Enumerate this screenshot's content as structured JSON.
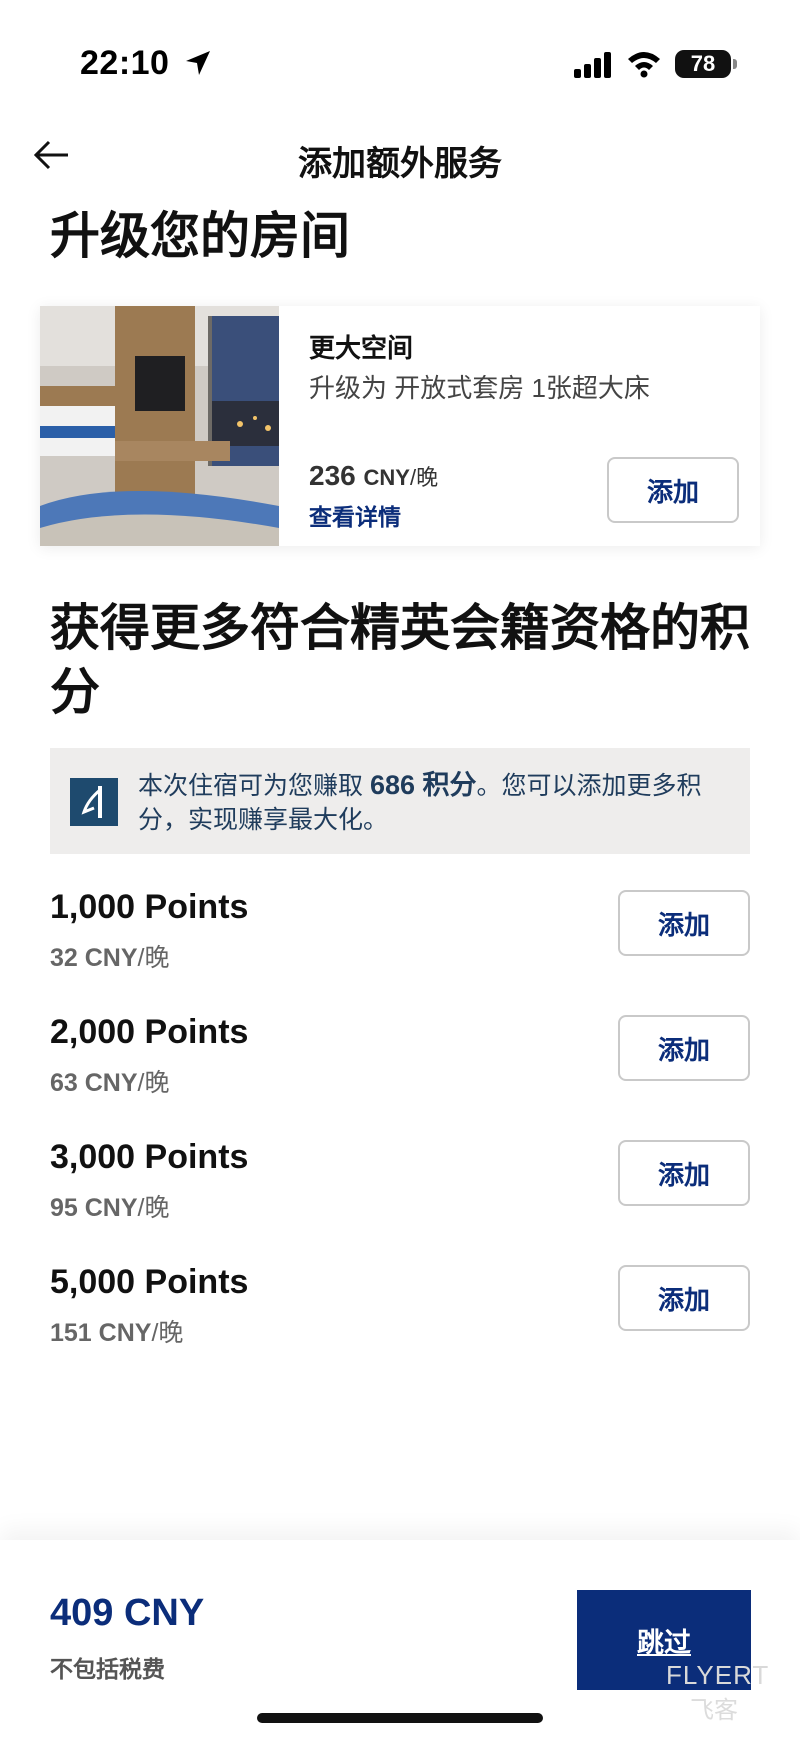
{
  "status_bar": {
    "time": "22:10",
    "battery": "78"
  },
  "header": {
    "title": "添加额外服务"
  },
  "upgrade_section": {
    "title": "升级您的房间",
    "card": {
      "heading": "更大空间",
      "description": "升级为 开放式套房 1张超大床",
      "price_value": "236",
      "price_currency": "CNY",
      "price_per": "/晚",
      "details_link": "查看详情",
      "add_label": "添加"
    }
  },
  "points_section": {
    "title": "获得更多符合精英会籍资格的积分",
    "info": {
      "prefix": "本次住宿可为您赚取 ",
      "points": "686 积分",
      "suffix": "。您可以添加更多积分，实现赚享最大化。"
    },
    "items": [
      {
        "title": "1,000 Points",
        "price": "32 CNY",
        "per": "/晚",
        "add_label": "添加"
      },
      {
        "title": "2,000 Points",
        "price": "63 CNY",
        "per": "/晚",
        "add_label": "添加"
      },
      {
        "title": "3,000 Points",
        "price": "95 CNY",
        "per": "/晚",
        "add_label": "添加"
      },
      {
        "title": "5,000 Points",
        "price": "151 CNY",
        "per": "/晚",
        "add_label": "添加"
      }
    ]
  },
  "footer": {
    "total": "409 CNY",
    "tax_note": "不包括税费",
    "skip_label": "跳过",
    "watermark": "FLYERT",
    "watermark_sub": "飞客"
  },
  "colors": {
    "brand_navy": "#0b2d7a",
    "info_bg": "#eeedec",
    "icon_teal": "#1e4a6e"
  }
}
